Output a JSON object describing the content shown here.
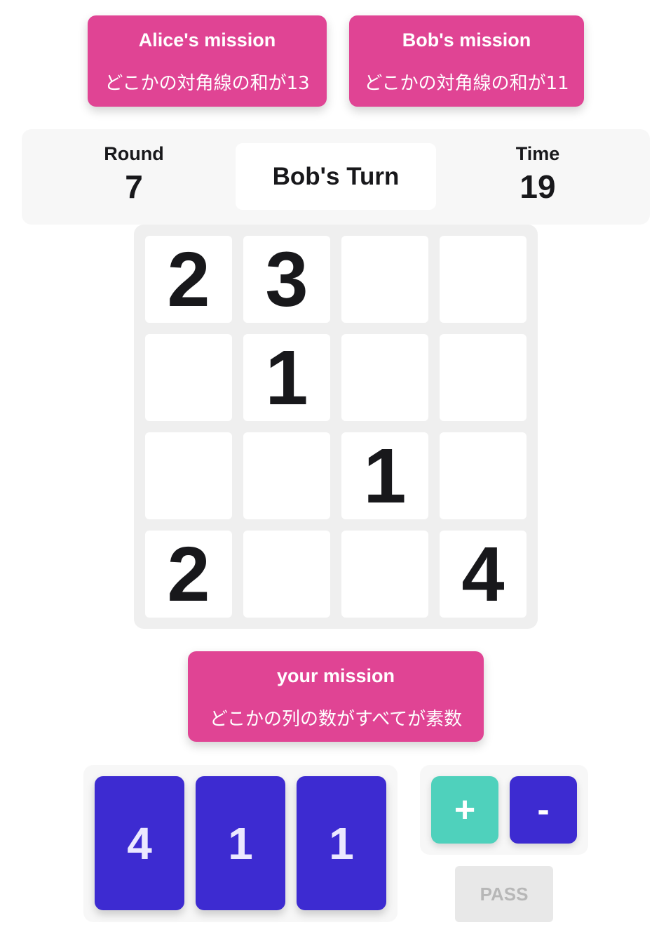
{
  "missions": {
    "alice": {
      "title": "Alice's mission",
      "desc": "どこかの対角線の和が13"
    },
    "bob": {
      "title": "Bob's mission",
      "desc": "どこかの対角線の和が11"
    },
    "yours": {
      "title": "your mission",
      "desc": "どこかの列の数がすべてが素数"
    }
  },
  "status": {
    "round_label": "Round",
    "round_value": "7",
    "turn": "Bob's Turn",
    "time_label": "Time",
    "time_value": "19"
  },
  "board": {
    "rows": [
      [
        "2",
        "3",
        "",
        ""
      ],
      [
        "",
        "1",
        "",
        ""
      ],
      [
        "",
        "",
        "1",
        ""
      ],
      [
        "2",
        "",
        "",
        "4"
      ]
    ]
  },
  "hand": {
    "cards": [
      "4",
      "1",
      "1"
    ]
  },
  "controls": {
    "plus": "+",
    "minus": "-",
    "pass": "PASS"
  },
  "colors": {
    "mission": "#e04494",
    "card": "#3d2bd1",
    "plus": "#4fd1bc",
    "minus": "#3d2bd1",
    "board_bg": "#efefef",
    "pass_disabled": "#e8e8e8"
  }
}
